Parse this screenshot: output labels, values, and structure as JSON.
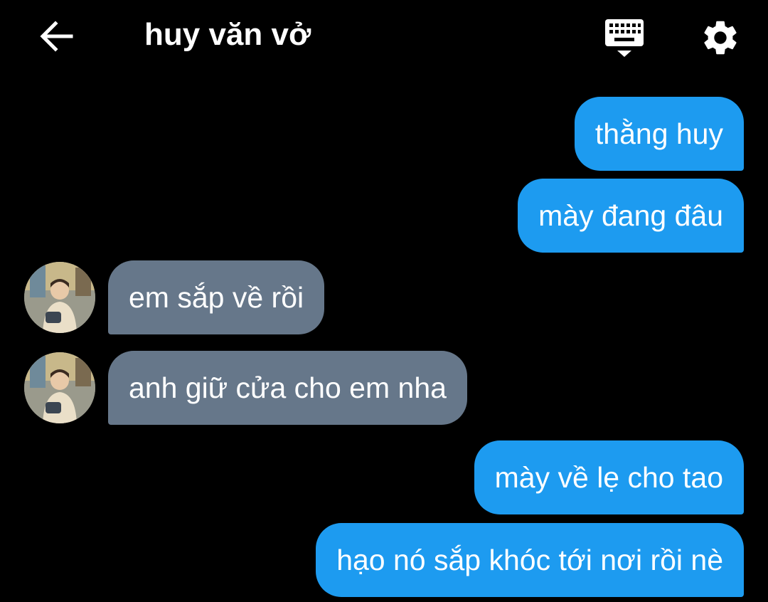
{
  "header": {
    "title": "huy văn vở",
    "back_icon": "arrow-left-icon",
    "keyboard_icon": "keyboard-icon",
    "settings_icon": "gear-icon"
  },
  "colors": {
    "background": "#000000",
    "sent_bubble": "#1d9bf0",
    "received_bubble": "#66778a",
    "text": "#ffffff"
  },
  "messages": [
    {
      "side": "sent",
      "text": "thằng huy"
    },
    {
      "side": "sent",
      "text": "mày đang đâu"
    },
    {
      "side": "received",
      "text": "em sắp về rồi"
    },
    {
      "side": "received",
      "text": "anh giữ cửa cho em nha"
    },
    {
      "side": "sent",
      "text": "mày về lẹ cho tao"
    },
    {
      "side": "sent",
      "text": "hạo nó sắp khóc tới nơi rồi nè"
    }
  ]
}
